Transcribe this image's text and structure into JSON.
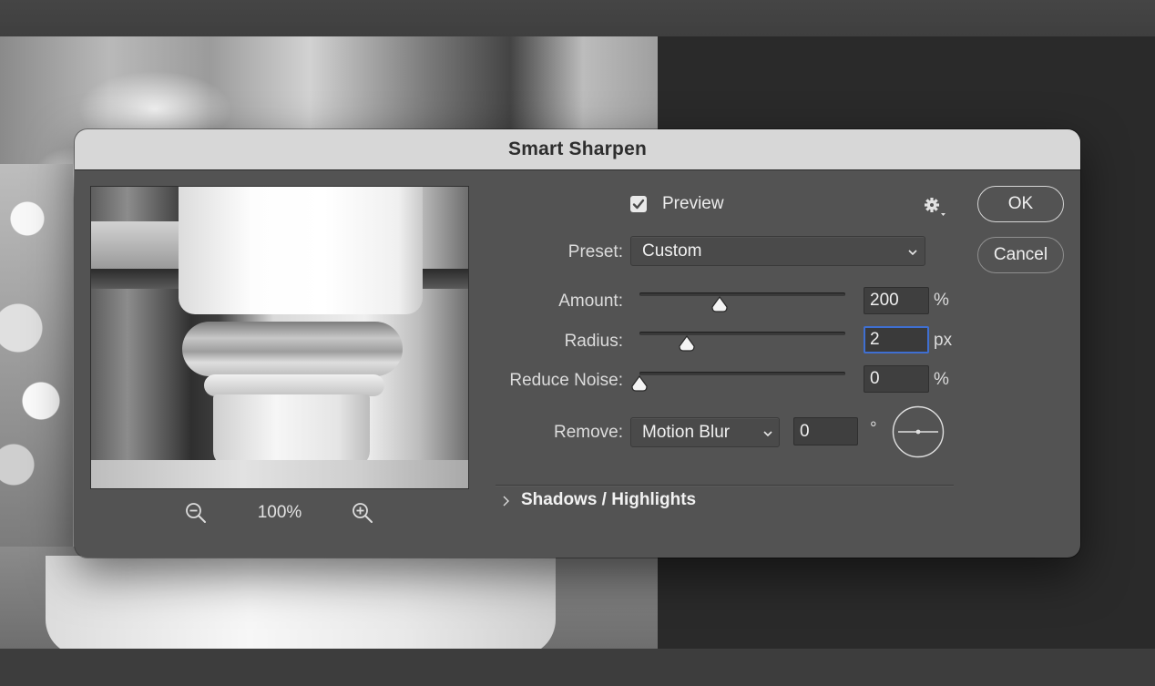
{
  "dialog": {
    "title": "Smart Sharpen",
    "preview_label": "Preview",
    "preview_checked": true,
    "zoom_level": "100%",
    "preset": {
      "label": "Preset:",
      "value": "Custom"
    },
    "amount": {
      "label": "Amount:",
      "value": "200",
      "unit": "%",
      "slider_fraction": 0.39
    },
    "radius": {
      "label": "Radius:",
      "value": "2",
      "unit": "px",
      "slider_fraction": 0.23
    },
    "reduce_noise": {
      "label": "Reduce Noise:",
      "value": "0",
      "unit": "%",
      "slider_fraction": 0.0
    },
    "remove": {
      "label": "Remove:",
      "value": "Motion Blur",
      "angle": "0",
      "angle_unit": "°"
    },
    "shadows_highlights_label": "Shadows / Highlights",
    "ok_label": "OK",
    "cancel_label": "Cancel"
  },
  "icons": {
    "zoom_out": "zoom-out-icon",
    "zoom_in": "zoom-in-icon",
    "gear": "gear-icon",
    "chevron": "chevron-down-icon",
    "disclosure": "chevron-right-icon",
    "angle_dial": "angle-dial-icon"
  },
  "colors": {
    "dialog_bg": "#535353",
    "title_bar": "#d7d7d7",
    "focus_ring": "#3f6fd1"
  }
}
